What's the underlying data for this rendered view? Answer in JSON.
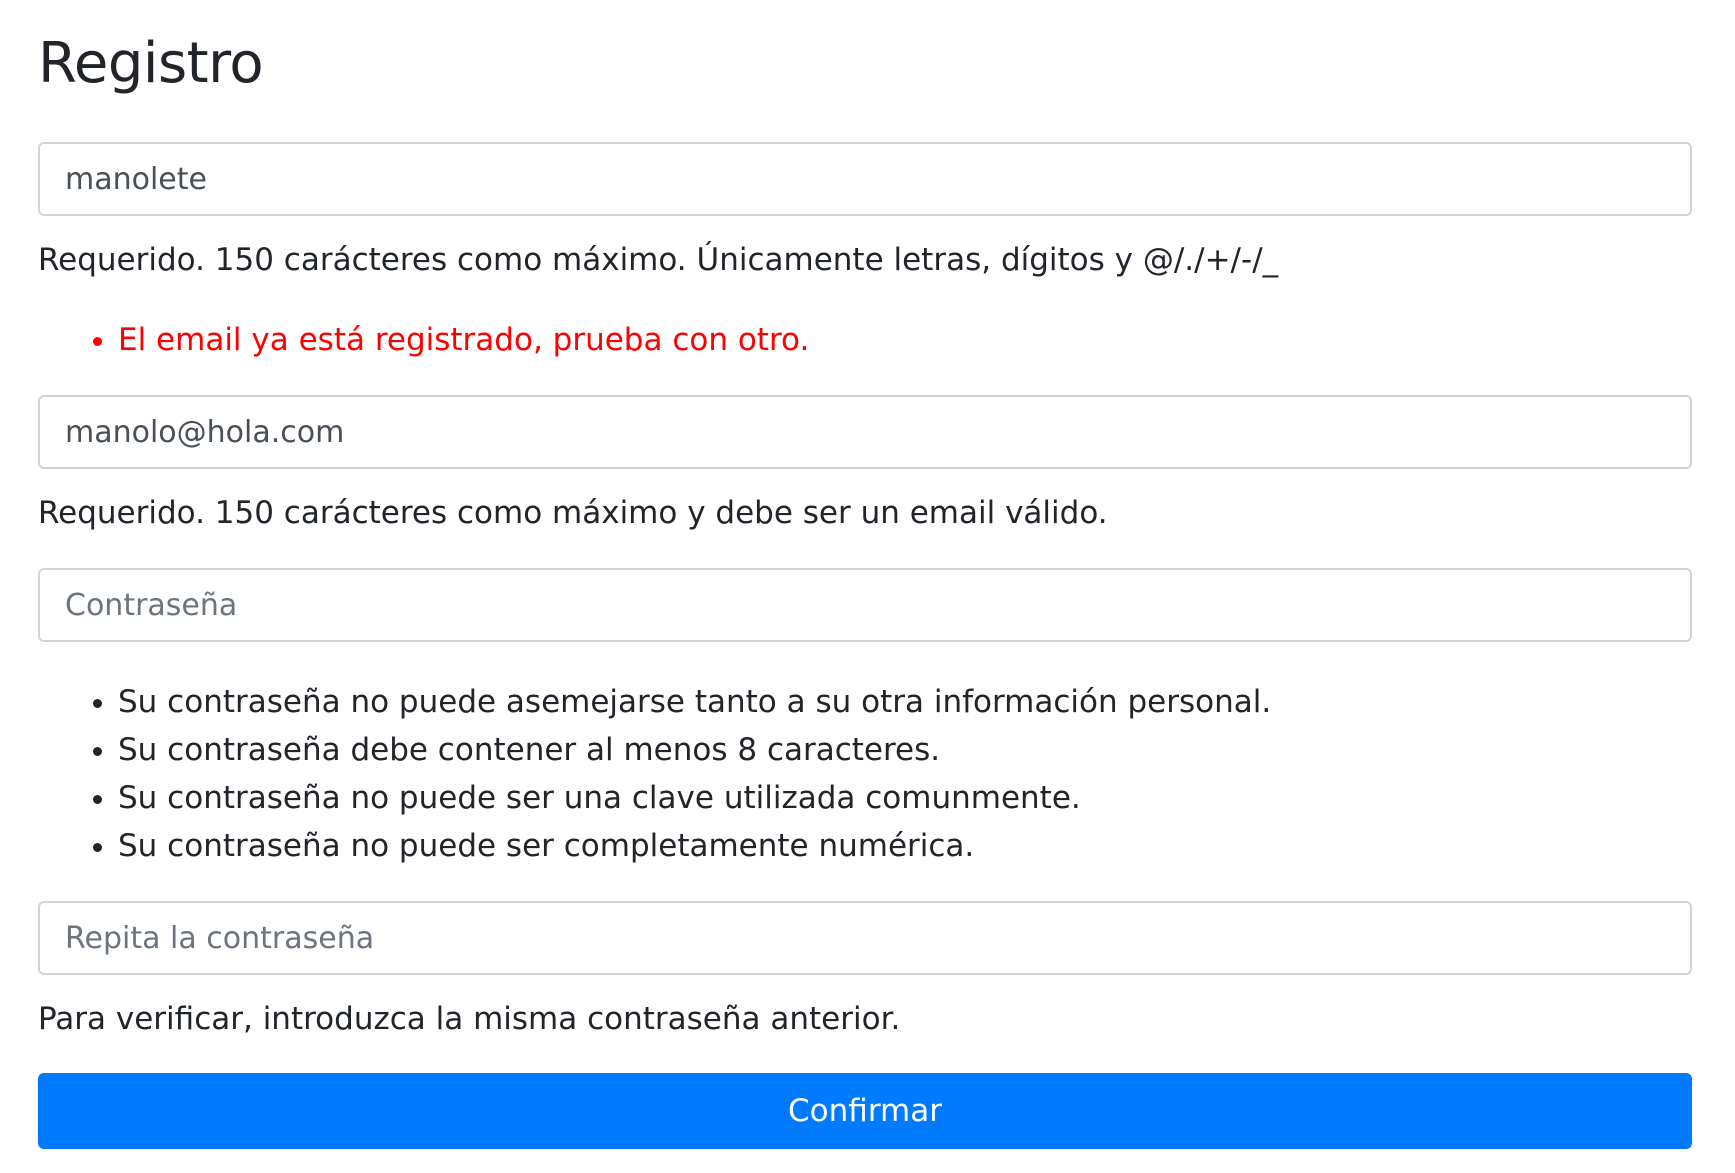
{
  "title": "Registro",
  "username": {
    "value": "manolete",
    "help": "Requerido. 150 carácteres como máximo. Únicamente letras, dígitos y @/./+/-/_"
  },
  "email_errors": [
    "El email ya está registrado, prueba con otro."
  ],
  "email": {
    "value": "manolo@hola.com",
    "help": "Requerido. 150 carácteres como máximo y debe ser un email válido."
  },
  "password": {
    "placeholder": "Contraseña",
    "rules": [
      "Su contraseña no puede asemejarse tanto a su otra información personal.",
      "Su contraseña debe contener al menos 8 caracteres.",
      "Su contraseña no puede ser una clave utilizada comunmente.",
      "Su contraseña no puede ser completamente numérica."
    ]
  },
  "password_confirm": {
    "placeholder": "Repita la contraseña",
    "help": "Para verificar, introduzca la misma contraseña anterior."
  },
  "submit_label": "Confirmar",
  "colors": {
    "primary": "#007bff",
    "error": "#ff0000",
    "border": "#ced4da"
  }
}
